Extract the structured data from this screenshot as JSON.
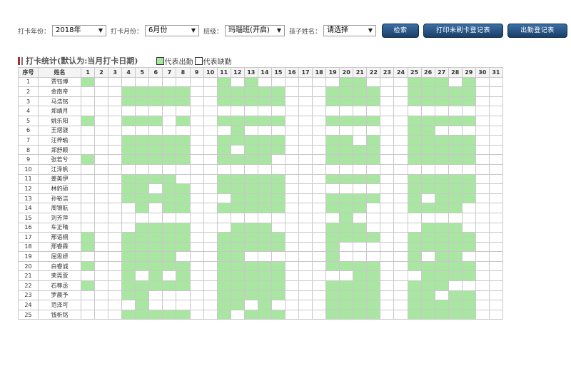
{
  "filters": {
    "year_label": "打卡年份：",
    "year_value": "2018年",
    "month_label": "打卡月份：",
    "month_value": "6月份",
    "class_label": "班级：",
    "class_value": "玛瑙班(开启)",
    "child_label": "孩子姓名：",
    "child_placeholder": "请选择",
    "dropdown_icon": "▼"
  },
  "buttons": {
    "search": "检索",
    "print_unsigned": "打印未刷卡登记表",
    "attendance_register": "出勤登记表"
  },
  "stats": {
    "title": "打卡统计(默认为:当月打卡日期)",
    "legend_present": "代表出勤",
    "legend_absent": "代表缺勤",
    "present_color": "#a8e6a1",
    "absent_color": "#ffffff"
  },
  "table": {
    "col_index": "序号",
    "col_name": "姓名",
    "days": [
      "1",
      "2",
      "3",
      "4",
      "5",
      "6",
      "7",
      "8",
      "9",
      "10",
      "11",
      "12",
      "13",
      "14",
      "15",
      "16",
      "17",
      "18",
      "19",
      "20",
      "21",
      "22",
      "23",
      "24",
      "25",
      "26",
      "27",
      "28",
      "29",
      "30",
      "31"
    ],
    "rows": [
      {
        "no": "1",
        "name": "贾钰博",
        "present": [
          1,
          11,
          13,
          20,
          21,
          25,
          26,
          27,
          29
        ]
      },
      {
        "no": "2",
        "name": "金南帝",
        "present": [
          4,
          5,
          6,
          7,
          8,
          11,
          12,
          13,
          14,
          15,
          19,
          20,
          21,
          22,
          25,
          26,
          27,
          28,
          29
        ]
      },
      {
        "no": "3",
        "name": "马浩铭",
        "present": [
          4,
          5,
          6,
          7,
          8,
          11,
          12,
          13,
          14,
          15,
          19,
          20,
          21,
          22,
          25,
          26,
          27,
          28,
          29
        ]
      },
      {
        "no": "4",
        "name": "郑靖月",
        "present": []
      },
      {
        "no": "5",
        "name": "姚乐阳",
        "present": [
          1,
          4,
          5,
          6,
          8,
          11,
          12,
          13,
          14,
          15,
          19,
          20,
          21,
          22,
          25,
          26,
          27,
          28,
          29
        ]
      },
      {
        "no": "6",
        "name": "王熠骁",
        "present": [
          12,
          25,
          26
        ]
      },
      {
        "no": "7",
        "name": "汪梓瑜",
        "present": [
          4,
          5,
          6,
          7,
          8,
          11,
          12,
          13,
          14,
          15,
          19,
          20,
          22,
          25,
          26,
          27,
          28,
          29
        ]
      },
      {
        "no": "8",
        "name": "郑舒颖",
        "present": [
          4,
          5,
          6,
          7,
          8,
          11,
          13,
          14,
          15,
          19,
          20,
          21,
          22,
          25,
          26,
          27,
          28,
          29
        ]
      },
      {
        "no": "9",
        "name": "张若兮",
        "present": [
          1,
          4,
          5,
          6,
          7,
          8,
          11,
          12,
          13,
          14,
          19,
          20,
          21,
          22,
          25,
          26,
          27,
          28,
          29
        ]
      },
      {
        "no": "10",
        "name": "江泽帆",
        "present": []
      },
      {
        "no": "11",
        "name": "姜美伊",
        "present": [
          4,
          5,
          6,
          7,
          11,
          12,
          13,
          14,
          15,
          19,
          20,
          21,
          22,
          25,
          26,
          27,
          28,
          29
        ]
      },
      {
        "no": "12",
        "name": "林豹硕",
        "present": [
          4,
          5,
          7,
          8,
          11,
          12,
          13,
          14,
          15,
          25,
          26,
          27,
          28,
          29
        ]
      },
      {
        "no": "13",
        "name": "孙裕洁",
        "present": [
          4,
          5,
          6,
          7,
          8,
          12,
          13,
          14,
          15,
          19,
          20,
          21,
          22,
          25,
          27,
          28,
          29
        ]
      },
      {
        "no": "14",
        "name": "周锦航",
        "present": [
          5,
          7,
          8,
          11,
          12,
          13,
          14,
          15,
          19,
          20,
          21,
          25,
          26,
          27,
          28
        ]
      },
      {
        "no": "15",
        "name": "刘芳萍",
        "present": [
          20
        ]
      },
      {
        "no": "16",
        "name": "车正晴",
        "present": [
          5,
          6,
          7,
          8,
          12,
          13,
          14,
          19,
          20,
          21,
          26,
          27,
          28
        ]
      },
      {
        "no": "17",
        "name": "邢语桐",
        "present": [
          1,
          4,
          5,
          6,
          7,
          8,
          11,
          12,
          13,
          14,
          15,
          19,
          20,
          21,
          22,
          25,
          26,
          27,
          28,
          29
        ]
      },
      {
        "no": "18",
        "name": "邢睿霖",
        "present": [
          1,
          4,
          5,
          6,
          7,
          8,
          11,
          12,
          13,
          14,
          15,
          19,
          25,
          26,
          27,
          28,
          29
        ]
      },
      {
        "no": "19",
        "name": "屈思妍",
        "present": [
          4,
          5,
          6,
          7,
          11,
          12,
          19,
          25,
          27,
          28
        ]
      },
      {
        "no": "20",
        "name": "白睿诚",
        "present": [
          1,
          4,
          5,
          6,
          7,
          8,
          11,
          12,
          13,
          14,
          15,
          19,
          20,
          21,
          22,
          25,
          26,
          27,
          28,
          29
        ]
      },
      {
        "no": "21",
        "name": "荣莞萱",
        "present": [
          4,
          6,
          8,
          11,
          12,
          13,
          14,
          15,
          21,
          22,
          26,
          27,
          28,
          29
        ]
      },
      {
        "no": "22",
        "name": "石尊丞",
        "present": [
          1,
          4,
          5,
          6,
          7,
          8,
          11,
          12,
          13,
          14,
          15,
          19,
          20,
          21,
          22,
          25,
          26,
          27
        ]
      },
      {
        "no": "23",
        "name": "罗晨予",
        "present": [
          4,
          5,
          11,
          12,
          13,
          14,
          15,
          19,
          20,
          21,
          22,
          25,
          26,
          28,
          29
        ]
      },
      {
        "no": "24",
        "name": "范泽可",
        "present": [
          5,
          11,
          12,
          14,
          19,
          20,
          21,
          22,
          25,
          26,
          27,
          28,
          29
        ]
      },
      {
        "no": "25",
        "name": "钱析铭",
        "present": [
          4,
          5,
          6,
          7,
          8,
          11,
          13,
          14,
          15,
          19,
          20,
          21,
          22,
          25,
          26,
          27,
          28,
          29
        ]
      }
    ]
  }
}
